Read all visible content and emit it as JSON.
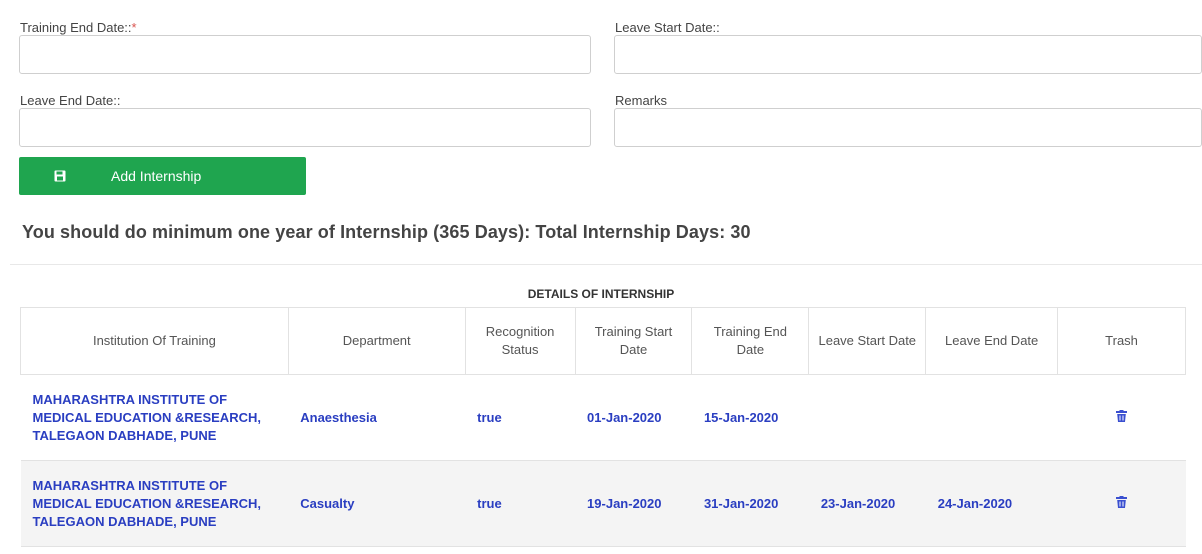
{
  "form": {
    "training_end_date": {
      "label": "Training End Date::",
      "required_mark": "*",
      "value": ""
    },
    "leave_start_date": {
      "label": "Leave Start Date::",
      "value": ""
    },
    "leave_end_date": {
      "label": "Leave End Date::",
      "value": ""
    },
    "remarks": {
      "label": "Remarks",
      "value": ""
    },
    "add_button_label": "Add Internship",
    "add_button_icon": "save-icon"
  },
  "summary_text": "You should do minimum one year of Internship (365 Days): Total Internship Days: 30",
  "table": {
    "caption": "DETAILS OF INTERNSHIP",
    "headers": {
      "institution": "Institution Of Training",
      "department": "Department",
      "recognition": "Recognition Status",
      "training_start": "Training Start Date",
      "training_end": "Training End Date",
      "leave_start": "Leave Start Date",
      "leave_end": "Leave End Date",
      "trash": "Trash"
    },
    "rows": [
      {
        "institution": "MAHARASHTRA INSTITUTE OF MEDICAL EDUCATION &RESEARCH, TALEGAON DABHADE, PUNE",
        "department": "Anaesthesia",
        "recognition": "true",
        "training_start": "01-Jan-2020",
        "training_end": "15-Jan-2020",
        "leave_start": "",
        "leave_end": "",
        "trash_icon": "trash-icon"
      },
      {
        "institution": "MAHARASHTRA INSTITUTE OF MEDICAL EDUCATION &RESEARCH, TALEGAON DABHADE, PUNE",
        "department": "Casualty",
        "recognition": "true",
        "training_start": "19-Jan-2020",
        "training_end": "31-Jan-2020",
        "leave_start": "23-Jan-2020",
        "leave_end": "24-Jan-2020",
        "trash_icon": "trash-icon"
      }
    ]
  },
  "colors": {
    "button_green": "#1fa54f",
    "link_blue": "#2a3ec1",
    "required_red": "#d9534f",
    "row_alt": "#f4f4f4"
  }
}
